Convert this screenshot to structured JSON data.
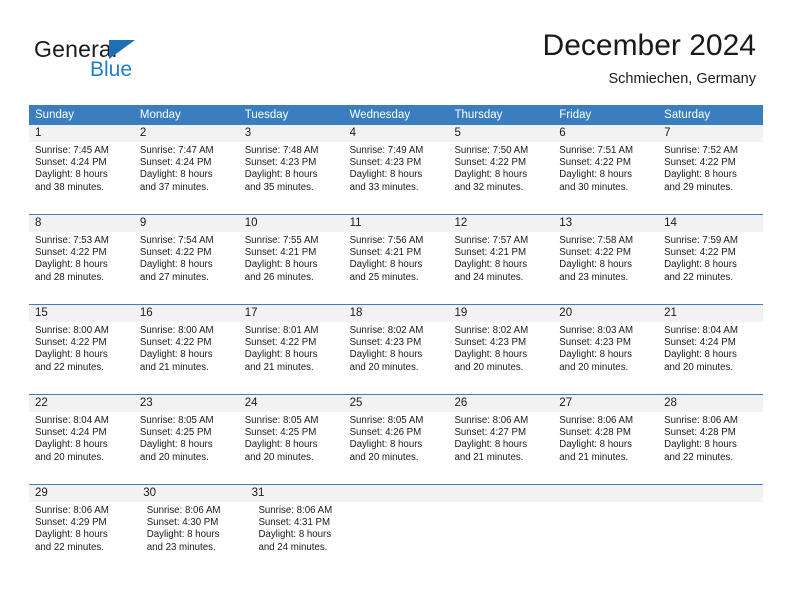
{
  "brand": {
    "name_part1": "General",
    "name_part2": "Blue",
    "triangle_color": "#1f6fb5",
    "blue_color": "#1f7ec4"
  },
  "header": {
    "title": "December 2024",
    "subtitle": "Schmiechen, Germany"
  },
  "theme": {
    "header_blue": "#3a7ebf",
    "daynum_band": "#f2f2f2",
    "text": "#1a1a1a"
  },
  "weekdays": [
    "Sunday",
    "Monday",
    "Tuesday",
    "Wednesday",
    "Thursday",
    "Friday",
    "Saturday"
  ],
  "weeks": [
    {
      "days": [
        {
          "num": "1",
          "sunrise": "Sunrise: 7:45 AM",
          "sunset": "Sunset: 4:24 PM",
          "daylight1": "Daylight: 8 hours",
          "daylight2": "and 38 minutes."
        },
        {
          "num": "2",
          "sunrise": "Sunrise: 7:47 AM",
          "sunset": "Sunset: 4:24 PM",
          "daylight1": "Daylight: 8 hours",
          "daylight2": "and 37 minutes."
        },
        {
          "num": "3",
          "sunrise": "Sunrise: 7:48 AM",
          "sunset": "Sunset: 4:23 PM",
          "daylight1": "Daylight: 8 hours",
          "daylight2": "and 35 minutes."
        },
        {
          "num": "4",
          "sunrise": "Sunrise: 7:49 AM",
          "sunset": "Sunset: 4:23 PM",
          "daylight1": "Daylight: 8 hours",
          "daylight2": "and 33 minutes."
        },
        {
          "num": "5",
          "sunrise": "Sunrise: 7:50 AM",
          "sunset": "Sunset: 4:22 PM",
          "daylight1": "Daylight: 8 hours",
          "daylight2": "and 32 minutes."
        },
        {
          "num": "6",
          "sunrise": "Sunrise: 7:51 AM",
          "sunset": "Sunset: 4:22 PM",
          "daylight1": "Daylight: 8 hours",
          "daylight2": "and 30 minutes."
        },
        {
          "num": "7",
          "sunrise": "Sunrise: 7:52 AM",
          "sunset": "Sunset: 4:22 PM",
          "daylight1": "Daylight: 8 hours",
          "daylight2": "and 29 minutes."
        }
      ]
    },
    {
      "days": [
        {
          "num": "8",
          "sunrise": "Sunrise: 7:53 AM",
          "sunset": "Sunset: 4:22 PM",
          "daylight1": "Daylight: 8 hours",
          "daylight2": "and 28 minutes."
        },
        {
          "num": "9",
          "sunrise": "Sunrise: 7:54 AM",
          "sunset": "Sunset: 4:22 PM",
          "daylight1": "Daylight: 8 hours",
          "daylight2": "and 27 minutes."
        },
        {
          "num": "10",
          "sunrise": "Sunrise: 7:55 AM",
          "sunset": "Sunset: 4:21 PM",
          "daylight1": "Daylight: 8 hours",
          "daylight2": "and 26 minutes."
        },
        {
          "num": "11",
          "sunrise": "Sunrise: 7:56 AM",
          "sunset": "Sunset: 4:21 PM",
          "daylight1": "Daylight: 8 hours",
          "daylight2": "and 25 minutes."
        },
        {
          "num": "12",
          "sunrise": "Sunrise: 7:57 AM",
          "sunset": "Sunset: 4:21 PM",
          "daylight1": "Daylight: 8 hours",
          "daylight2": "and 24 minutes."
        },
        {
          "num": "13",
          "sunrise": "Sunrise: 7:58 AM",
          "sunset": "Sunset: 4:22 PM",
          "daylight1": "Daylight: 8 hours",
          "daylight2": "and 23 minutes."
        },
        {
          "num": "14",
          "sunrise": "Sunrise: 7:59 AM",
          "sunset": "Sunset: 4:22 PM",
          "daylight1": "Daylight: 8 hours",
          "daylight2": "and 22 minutes."
        }
      ]
    },
    {
      "days": [
        {
          "num": "15",
          "sunrise": "Sunrise: 8:00 AM",
          "sunset": "Sunset: 4:22 PM",
          "daylight1": "Daylight: 8 hours",
          "daylight2": "and 22 minutes."
        },
        {
          "num": "16",
          "sunrise": "Sunrise: 8:00 AM",
          "sunset": "Sunset: 4:22 PM",
          "daylight1": "Daylight: 8 hours",
          "daylight2": "and 21 minutes."
        },
        {
          "num": "17",
          "sunrise": "Sunrise: 8:01 AM",
          "sunset": "Sunset: 4:22 PM",
          "daylight1": "Daylight: 8 hours",
          "daylight2": "and 21 minutes."
        },
        {
          "num": "18",
          "sunrise": "Sunrise: 8:02 AM",
          "sunset": "Sunset: 4:23 PM",
          "daylight1": "Daylight: 8 hours",
          "daylight2": "and 20 minutes."
        },
        {
          "num": "19",
          "sunrise": "Sunrise: 8:02 AM",
          "sunset": "Sunset: 4:23 PM",
          "daylight1": "Daylight: 8 hours",
          "daylight2": "and 20 minutes."
        },
        {
          "num": "20",
          "sunrise": "Sunrise: 8:03 AM",
          "sunset": "Sunset: 4:23 PM",
          "daylight1": "Daylight: 8 hours",
          "daylight2": "and 20 minutes."
        },
        {
          "num": "21",
          "sunrise": "Sunrise: 8:04 AM",
          "sunset": "Sunset: 4:24 PM",
          "daylight1": "Daylight: 8 hours",
          "daylight2": "and 20 minutes."
        }
      ]
    },
    {
      "days": [
        {
          "num": "22",
          "sunrise": "Sunrise: 8:04 AM",
          "sunset": "Sunset: 4:24 PM",
          "daylight1": "Daylight: 8 hours",
          "daylight2": "and 20 minutes."
        },
        {
          "num": "23",
          "sunrise": "Sunrise: 8:05 AM",
          "sunset": "Sunset: 4:25 PM",
          "daylight1": "Daylight: 8 hours",
          "daylight2": "and 20 minutes."
        },
        {
          "num": "24",
          "sunrise": "Sunrise: 8:05 AM",
          "sunset": "Sunset: 4:25 PM",
          "daylight1": "Daylight: 8 hours",
          "daylight2": "and 20 minutes."
        },
        {
          "num": "25",
          "sunrise": "Sunrise: 8:05 AM",
          "sunset": "Sunset: 4:26 PM",
          "daylight1": "Daylight: 8 hours",
          "daylight2": "and 20 minutes."
        },
        {
          "num": "26",
          "sunrise": "Sunrise: 8:06 AM",
          "sunset": "Sunset: 4:27 PM",
          "daylight1": "Daylight: 8 hours",
          "daylight2": "and 21 minutes."
        },
        {
          "num": "27",
          "sunrise": "Sunrise: 8:06 AM",
          "sunset": "Sunset: 4:28 PM",
          "daylight1": "Daylight: 8 hours",
          "daylight2": "and 21 minutes."
        },
        {
          "num": "28",
          "sunrise": "Sunrise: 8:06 AM",
          "sunset": "Sunset: 4:28 PM",
          "daylight1": "Daylight: 8 hours",
          "daylight2": "and 22 minutes."
        }
      ]
    },
    {
      "days": [
        {
          "num": "29",
          "sunrise": "Sunrise: 8:06 AM",
          "sunset": "Sunset: 4:29 PM",
          "daylight1": "Daylight: 8 hours",
          "daylight2": "and 22 minutes."
        },
        {
          "num": "30",
          "sunrise": "Sunrise: 8:06 AM",
          "sunset": "Sunset: 4:30 PM",
          "daylight1": "Daylight: 8 hours",
          "daylight2": "and 23 minutes."
        },
        {
          "num": "31",
          "sunrise": "Sunrise: 8:06 AM",
          "sunset": "Sunset: 4:31 PM",
          "daylight1": "Daylight: 8 hours",
          "daylight2": "and 24 minutes."
        },
        null,
        null,
        null,
        null
      ]
    }
  ]
}
